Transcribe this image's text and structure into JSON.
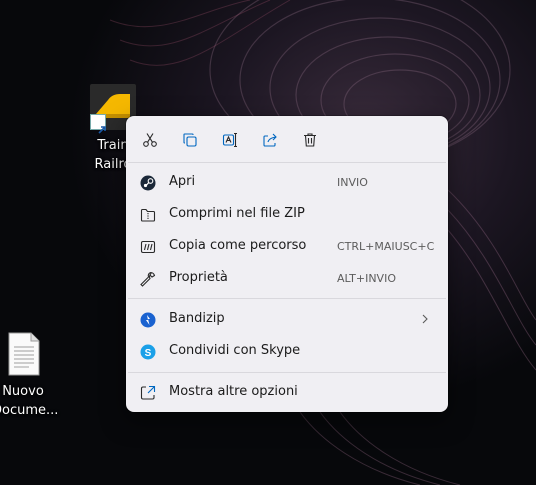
{
  "desktop": {
    "icons": [
      {
        "label_line1": "Train",
        "label_line2": "Railro"
      },
      {
        "label_line1": "Nuovo",
        "label_line2": "Docume..."
      }
    ]
  },
  "context_menu": {
    "toolbar": [
      "cut-icon",
      "copy-icon",
      "rename-icon",
      "share-icon",
      "delete-icon"
    ],
    "items": [
      {
        "label": "Apri",
        "shortcut": "INVIO",
        "icon": "steam-icon"
      },
      {
        "label": "Comprimi nel file ZIP",
        "shortcut": "",
        "icon": "zip-folder-icon"
      },
      {
        "label": "Copia come percorso",
        "shortcut": "CTRL+MAIUSC+C",
        "icon": "copy-path-icon"
      },
      {
        "label": "Proprietà",
        "shortcut": "ALT+INVIO",
        "icon": "wrench-icon"
      },
      {
        "label": "Bandizip",
        "shortcut": "",
        "icon": "bandizip-icon"
      },
      {
        "label": "Condividi con Skype",
        "shortcut": "",
        "icon": "skype-icon"
      },
      {
        "label": "Mostra altre opzioni",
        "shortcut": "",
        "icon": "more-options-icon"
      }
    ]
  },
  "colors": {
    "menu_bg": "#f0eff3",
    "accent": "#0067c0",
    "train_yellow": "#f5b800"
  }
}
